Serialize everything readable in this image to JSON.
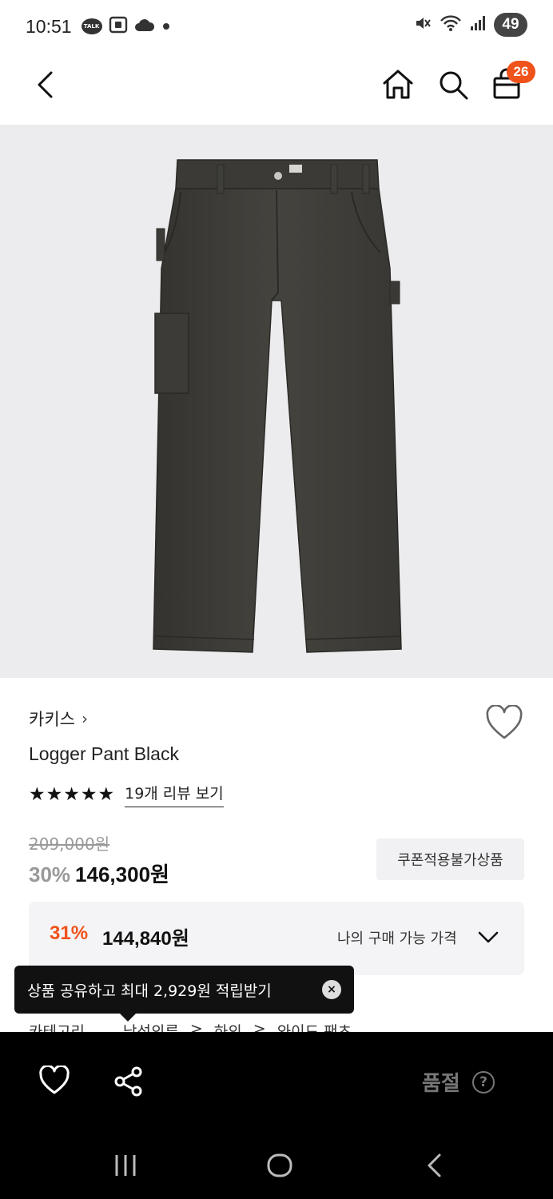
{
  "status_bar": {
    "time": "10:51",
    "talk_label": "TALK",
    "battery_level": "49"
  },
  "top_nav": {
    "cart_count": "26"
  },
  "product": {
    "brand": "카키스",
    "brand_chevron": "›",
    "name": "Logger Pant Black",
    "stars": "★★★★★",
    "rating_stars": 5,
    "review_link": "19개 리뷰 보기",
    "original_price": "209,000원",
    "discount_rate": "30%",
    "sale_price": "146,300원",
    "coupon_badge": "쿠폰적용불가상품"
  },
  "my_price": {
    "discount_rate": "31%",
    "price": "144,840원",
    "label": "나의 구매 가능 가격"
  },
  "category": {
    "label": "카테고리",
    "path": [
      "남성의류",
      "하의",
      "와이드 팬츠"
    ],
    "separator": ">"
  },
  "tooltip": {
    "text": "상품 공유하고 최대 2,929원 적립받기",
    "close_symbol": "×"
  },
  "bottom_bar": {
    "soldout_label": "품절",
    "help_symbol": "?"
  },
  "colors": {
    "accent": "#f0521c",
    "image_bg": "#ececee",
    "pants": "#3d3c38",
    "bottom_bar": "#000000"
  }
}
